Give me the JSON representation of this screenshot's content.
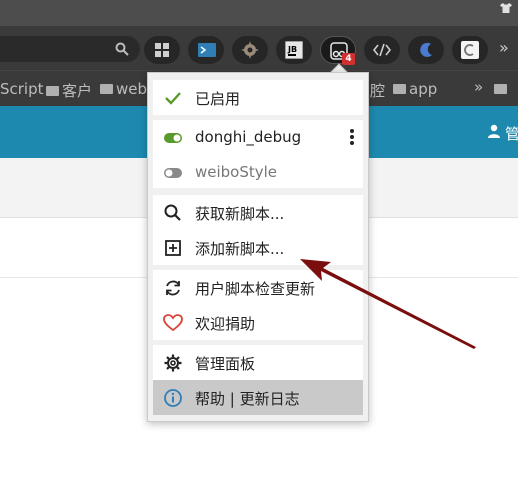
{
  "toolbar": {
    "extensions": [
      {
        "icon": "grid-icon"
      },
      {
        "icon": "terminal-icon"
      },
      {
        "icon": "gear-icon"
      },
      {
        "icon": "jetbrains-icon"
      },
      {
        "icon": "tampermonkey-icon",
        "badge": "4"
      },
      {
        "icon": "code-icon"
      },
      {
        "icon": "moon-icon"
      },
      {
        "icon": "chrome-ext-icon"
      }
    ],
    "more": "»"
  },
  "bookmarks": {
    "items": [
      "Script",
      "客户",
      "web",
      "腔",
      "app"
    ],
    "more": "»"
  },
  "page": {
    "header_text": "管"
  },
  "menu": {
    "enabled_label": "已启用",
    "scripts": [
      {
        "name": "donghi_debug",
        "enabled": true
      },
      {
        "name": "weiboStyle",
        "enabled": false
      }
    ],
    "get_new_script": "获取新脚本...",
    "add_new_script": "添加新脚本...",
    "check_updates": "用户脚本检查更新",
    "donate": "欢迎捐助",
    "dashboard": "管理面板",
    "help": "帮助 | 更新日志"
  },
  "colors": {
    "accent_green": "#5a9a2c",
    "header_blue": "#1e89ae",
    "annotation_arrow": "#7a0d0d",
    "badge_red": "#d23030"
  }
}
